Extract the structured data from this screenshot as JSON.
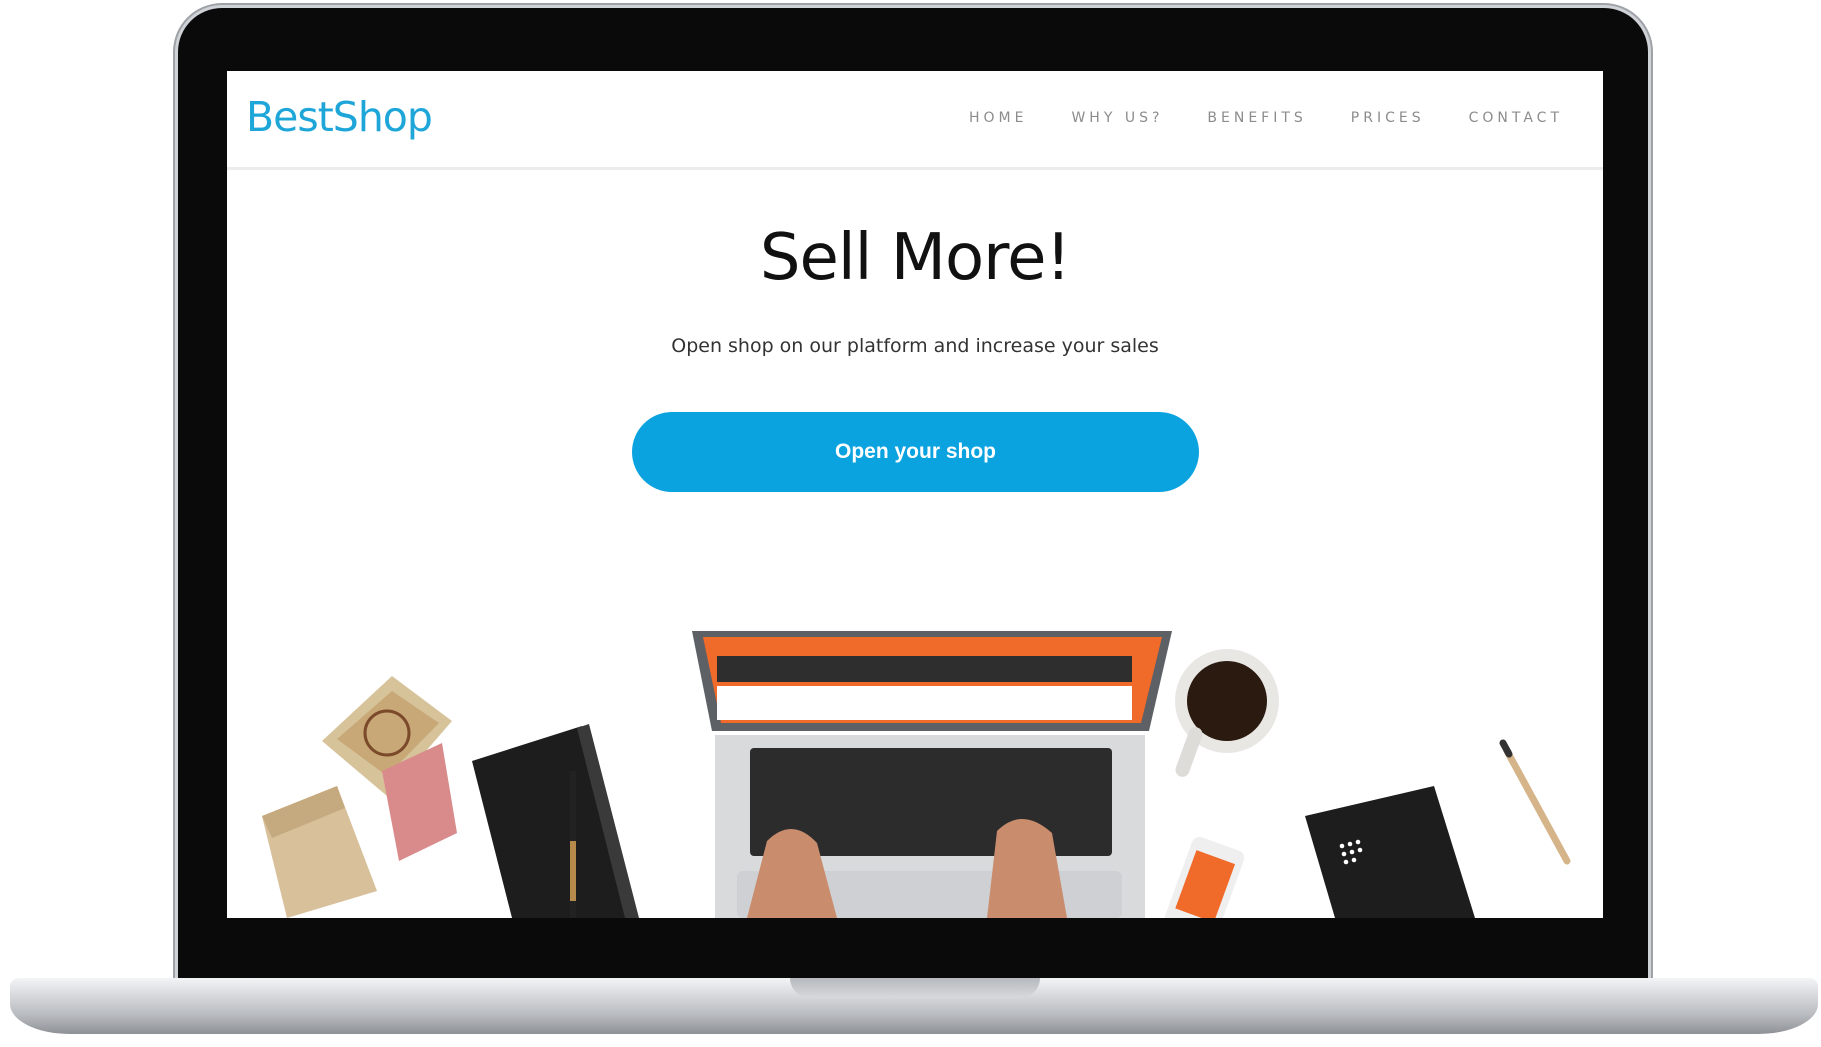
{
  "site": {
    "logo": "BestShop",
    "nav": [
      "HOME",
      "WHY US?",
      "BENEFITS",
      "PRICES",
      "CONTACT"
    ]
  },
  "hero": {
    "title": "Sell More!",
    "subtitle": "Open shop on our platform and increase your sales",
    "cta_label": "Open your shop"
  },
  "colors": {
    "brand": "#1fa6d9",
    "cta": "#0aa3e0"
  }
}
